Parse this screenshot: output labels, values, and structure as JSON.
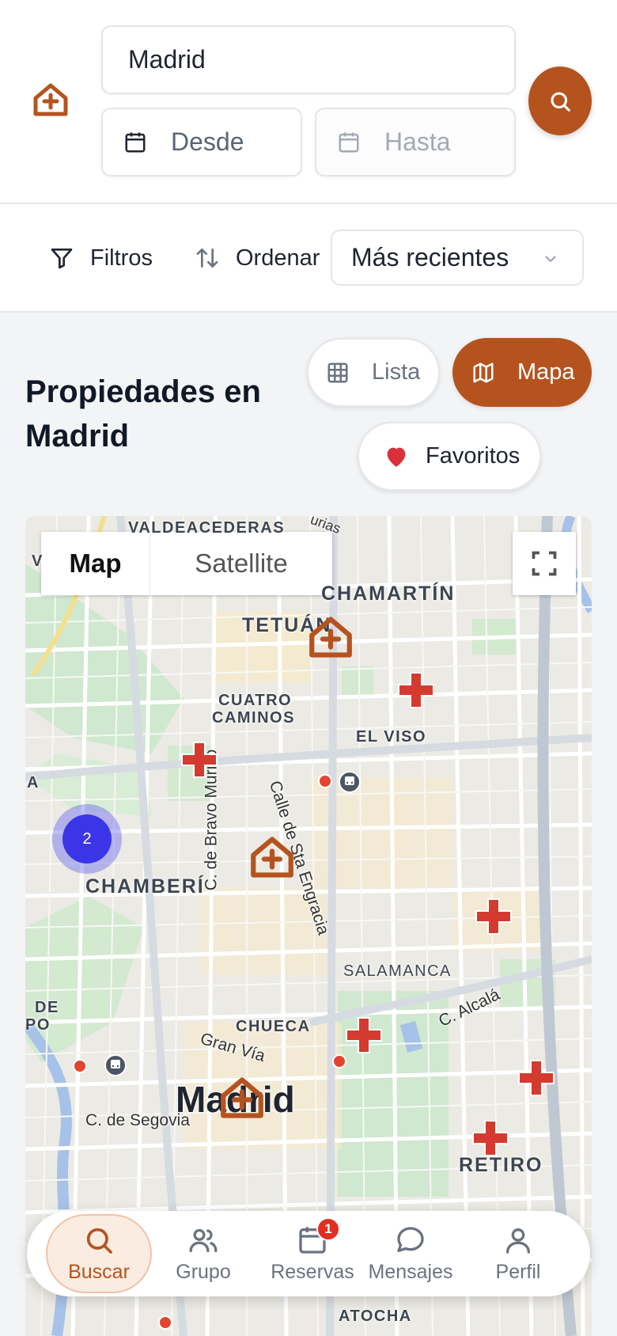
{
  "search": {
    "city_value": "Madrid",
    "from_placeholder": "Desde",
    "to_placeholder": "Hasta"
  },
  "filters": {
    "filters_label": "Filtros",
    "sort_label": "Ordenar",
    "sort_selected": "Más recientes"
  },
  "main": {
    "title": "Propiedades en Madrid",
    "view_list_label": "Lista",
    "view_map_label": "Mapa",
    "favorites_label": "Favoritos"
  },
  "map": {
    "type_map_label": "Map",
    "type_satellite_label": "Satellite",
    "cluster_count": "2",
    "district_labels": [
      "VALDEACEDERAS",
      "CHAMARTÍN",
      "TETUÁN",
      "CUATRO",
      "CAMINOS",
      "EL VISO",
      "CHAMBERÍ",
      "SALAMANCA",
      "CHUECA",
      "RETIRO",
      "ATOCHA",
      "DE",
      "PO",
      "A",
      "V"
    ],
    "city_label": "Madrid",
    "street_labels": [
      "C. de Bravo Murillo",
      "Calle de Sta Engracia",
      "C. Alcalá",
      "Gran Vía",
      "C. de Segovia",
      "urias"
    ]
  },
  "nav": {
    "items": [
      {
        "label": "Buscar",
        "icon": "search-icon"
      },
      {
        "label": "Grupo",
        "icon": "group-icon"
      },
      {
        "label": "Reservas",
        "icon": "calendar-icon",
        "badge": "1"
      },
      {
        "label": "Mensajes",
        "icon": "message-icon"
      },
      {
        "label": "Perfil",
        "icon": "user-icon"
      }
    ]
  },
  "colors": {
    "brand": "#b5531f",
    "hospital_red": "#d43a2f",
    "cluster_blue": "#3b35e8"
  }
}
